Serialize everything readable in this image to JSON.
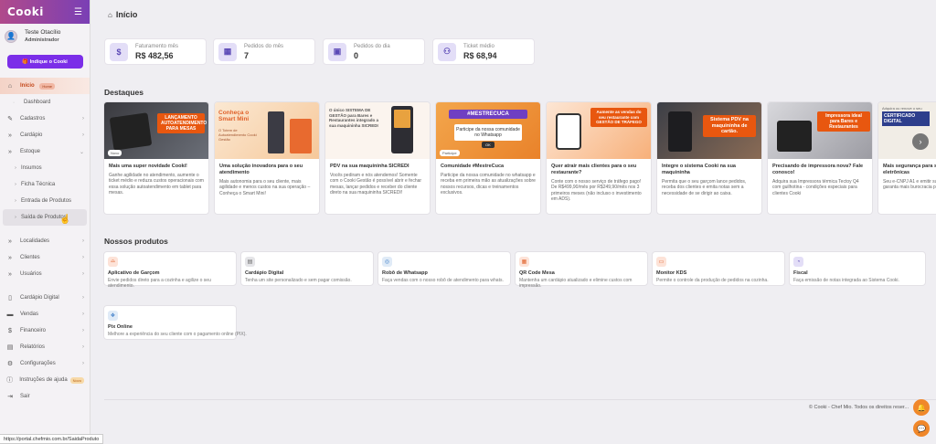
{
  "app": {
    "logo": "Cooki",
    "menu_icon": "hamburger-icon"
  },
  "user": {
    "name": "Teste Otacílio",
    "role": "Administrador"
  },
  "sidebar": {
    "indique_label": "🎁 Indique o Cooki",
    "items": [
      {
        "label": "Início",
        "badge": "Home",
        "active": true
      },
      {
        "label": "Dashboard"
      },
      {
        "label": "Cadastros"
      },
      {
        "label": "Cardápio"
      },
      {
        "label": "Estoque"
      },
      {
        "label": "Insumos"
      },
      {
        "label": "Ficha Técnica"
      },
      {
        "label": "Entrada de Produtos"
      },
      {
        "label": "Saída de Produtos"
      },
      {
        "label": "Localidades"
      },
      {
        "label": "Clientes"
      },
      {
        "label": "Usuários"
      },
      {
        "label": "Cardápio Digital"
      },
      {
        "label": "Vendas"
      },
      {
        "label": "Financeiro"
      },
      {
        "label": "Relatórios"
      },
      {
        "label": "Configurações"
      },
      {
        "label": "Instruções de ajuda",
        "badge": "Novo"
      },
      {
        "label": "Sair"
      }
    ]
  },
  "status_url": "https://portal.chefmio.com.br/SaidaProduto",
  "page": {
    "title": "Início"
  },
  "stats": [
    {
      "label": "Faturamento mês",
      "value": "R$ 482,56",
      "icon": "dollar-icon"
    },
    {
      "label": "Pedidos do mês",
      "value": "7",
      "icon": "calendar-icon"
    },
    {
      "label": "Pedidos do dia",
      "value": "0",
      "icon": "calendar-day-icon"
    },
    {
      "label": "Ticket médio",
      "value": "R$ 68,94",
      "icon": "user-ticket-icon"
    }
  ],
  "highlights": {
    "title": "Destaques",
    "cards": [
      {
        "title": "Mais uma super novidade Cooki!",
        "desc": "Ganhe agilidade no atendimento, aumente o ticket médio e reduza custos operacionais com essa solução autoatendimento em tablet para mesas.",
        "img_text": "LANÇAMENTO AUTOATENDIMENTO PARA MESAS",
        "tag": "Novo"
      },
      {
        "title": "Uma solução inovadora para o seu atendimento",
        "desc": "Mais autonomia para o seu cliente, mais agilidade e menos custos na sua operação – Conheça o Smart Mini!",
        "img_text": "Conheça o Smart Mini",
        "img_sub": "O Totem de Autoatendimento Cooki Gestão"
      },
      {
        "title": "PDV na sua maquininha SICREDI",
        "desc": "Vocês pediram e nós atendemos! Somente com o Cooki Gestão é possível abrir e fechar mesas, lançar pedidos e receber do cliente direto na sua maquininha SICREDI!",
        "img_text": "O único SISTEMA DE GESTÃO para Bares e Restaurantes integrado a sua maquininha SICREDI"
      },
      {
        "title": "Comunidade #MestreCuca",
        "desc": "Participe da nossa comunidade no whatsapp e receba em primeira mão as atualizações sobre nossos recursos, dicas e treinamentos exclusivos.",
        "img_text": "#MESTRECUCA",
        "img_sub": "Participe da nossa comunidade no Whatsapp",
        "img_btn": "OK",
        "tag": "Participe"
      },
      {
        "title": "Quer atrair mais clientes para o seu restaurante?",
        "desc": "Conte com o nosso serviço de tráfego pago! De R$499,90/mês por R$249,90/mês nos 3 primeiros meses (não incluso o investimento em ADS).",
        "img_text": "Aumente as vendas do seu restaurante com GESTÃO DE TRÁFEGO"
      },
      {
        "title": "Integre o sistema Cooki na sua maquininha",
        "desc": "Permita que o seu garçom lance pedidos, receba dos clientes e emita notas sem a necessidade de se dirigir ao caixa.",
        "img_text": "Sistema PDV na maquininha de cartão."
      },
      {
        "title": "Precisando de impressora nova? Fale conosco!",
        "desc": "Adquira sua Impressora térmica Tectoy Q4 com guilhotina - condições especiais para clientes Cooki",
        "img_text": "Impressora ideal para Bares e Restaurantes"
      },
      {
        "title": "Mais segurança para suas notas eletrônicas",
        "desc": "Seu e-CNPJ A1 e emitir suas notas. Clique e garanta mais burocracia para o",
        "img_text": "CERTIFICADO DIGITAL",
        "img_sub": "Adquira ou renove o seu"
      }
    ]
  },
  "products": {
    "title": "Nossos produtos",
    "items": [
      {
        "name": "Aplicativo de Garçom",
        "desc": "Envie pedidos direto para a cozinha e agilize o seu atendimento.",
        "icon": "waiter-icon",
        "color": "#fde3d8",
        "fg": "#e0612a"
      },
      {
        "name": "Cardápio Digital",
        "desc": "Tenha um site personalizado e sem pagar comissão.",
        "icon": "menu-book-icon",
        "color": "#e5e5e8",
        "fg": "#666"
      },
      {
        "name": "Robô de Whatsapp",
        "desc": "Faça vendas com o nosso robô de atendimento para whats.",
        "icon": "robot-icon",
        "color": "#e0ebf7",
        "fg": "#3e7fc9"
      },
      {
        "name": "QR Code Mesa",
        "desc": "Mantenha um cardápio atualizado e elimine custos com impressão.",
        "icon": "qrcode-icon",
        "color": "#fde3d8",
        "fg": "#e0612a"
      },
      {
        "name": "Monitor KDS",
        "desc": "Permite o controle da produção de pedidos na cozinha.",
        "icon": "monitor-icon",
        "color": "#fde3d8",
        "fg": "#e0612a"
      },
      {
        "name": "Fiscal",
        "desc": "Faça emissão de notas integrada ao Sistema Cooki.",
        "icon": "fiscal-icon",
        "color": "#e3def7",
        "fg": "#5b49b6"
      },
      {
        "name": "Pix Online",
        "desc": "Melhore a experiência do seu cliente com o pagamento online (PIX).",
        "icon": "pix-icon",
        "color": "#e0ebf7",
        "fg": "#3e7fc9"
      }
    ]
  },
  "footer": {
    "copyright": "© Cooki - Chef Mio. Todos os direitos reser..."
  }
}
